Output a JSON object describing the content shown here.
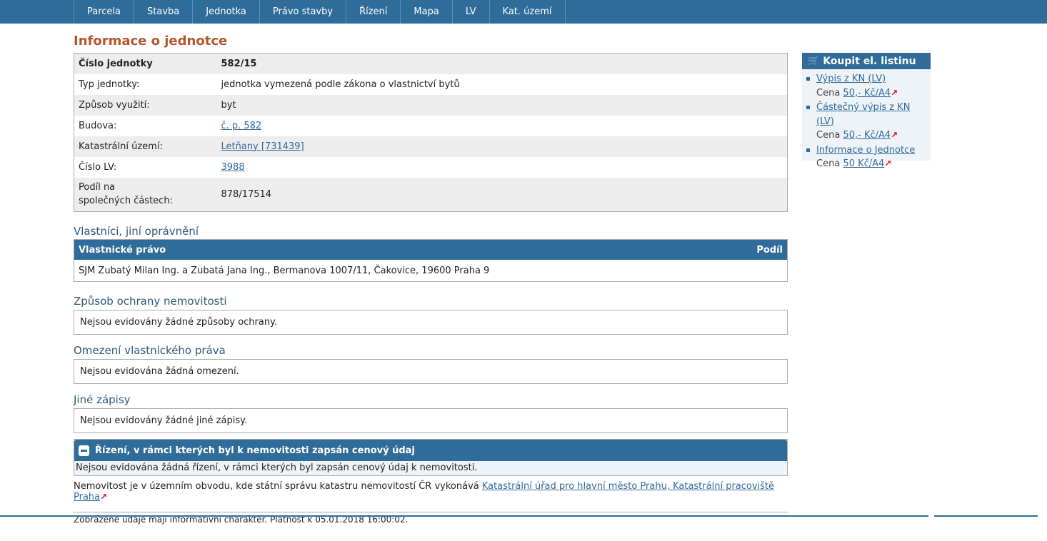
{
  "nav": {
    "items": [
      "Parcela",
      "Stavba",
      "Jednotka",
      "Právo stavby",
      "Řízení",
      "Mapa",
      "LV",
      "Kat. území"
    ]
  },
  "page_title": "Informace o jednotce",
  "info": {
    "cislo_jednotky": {
      "label": "Číslo jednotky",
      "value": "582/15"
    },
    "typ_jednotky": {
      "label": "Typ jednotky:",
      "value": "jednotka vymezená podle zákona o vlastnictví bytů"
    },
    "zpusob_vyuziti": {
      "label": "Způsob využití:",
      "value": "byt"
    },
    "budova": {
      "label": "Budova:",
      "value": "č. p. 582"
    },
    "katastralni_uzemi": {
      "label": "Katastrální území:",
      "value": "Letňany [731439]"
    },
    "cislo_lv": {
      "label": "Číslo LV:",
      "value": "3988"
    },
    "podil_line1": "Podíl na",
    "podil_line2": "společných částech:",
    "podil_value": "878/17514"
  },
  "owners": {
    "title": "Vlastníci, jiní oprávnění",
    "col_right": "Vlastnické právo",
    "col_share": "Podíl",
    "row": "SJM Zubatý Milan Ing. a Zubatá Jana Ing., Bermanova 1007/11, Čakovice, 19600 Praha 9"
  },
  "ochrana": {
    "title": "Způsob ochrany nemovitosti",
    "text": "Nejsou evidovány žádné způsoby ochrany."
  },
  "omezeni": {
    "title": "Omezení vlastnického práva",
    "text": "Nejsou evidována žádná omezení."
  },
  "jine": {
    "title": "Jiné zápisy",
    "text": "Nejsou evidovány žádné jiné zápisy."
  },
  "rizeni": {
    "title": "Řízení, v rámci kterých byl k nemovitosti zapsán cenový údaj",
    "text": "Nejsou evidována žádná řízení, v rámci kterých byl zapsán cenový údaj k nemovitosti."
  },
  "footer": {
    "office_prefix": "Nemovitost je v územním obvodu, kde státní správu katastru nemovitostí ČR vykonává",
    "office_link": "Katastrální úřad pro hlavní město Prahu, Katastrální pracoviště Praha",
    "validity": "Zobrazené údaje mají informativní charakter. Platnost k 05.01.2018 16:00:02."
  },
  "sidebar": {
    "title": "Koupit el. listinu",
    "price_prefix": "Cena",
    "items": [
      {
        "label": "Výpis z KN (LV)",
        "price": "50,- Kč/A4"
      },
      {
        "label": "Částečný výpis z KN (LV)",
        "price": "50,- Kč/A4"
      },
      {
        "label": "Informace o Jednotce",
        "price": "50 Kč/A4"
      }
    ]
  },
  "icons": {
    "external": "external-link-arrow",
    "cart": "cart-icon",
    "minus": "collapse-icon"
  },
  "colors": {
    "nav": "#2f6c99",
    "title": "#b6542b",
    "link": "#2f6a9a",
    "heading": "#2f5a7c"
  }
}
